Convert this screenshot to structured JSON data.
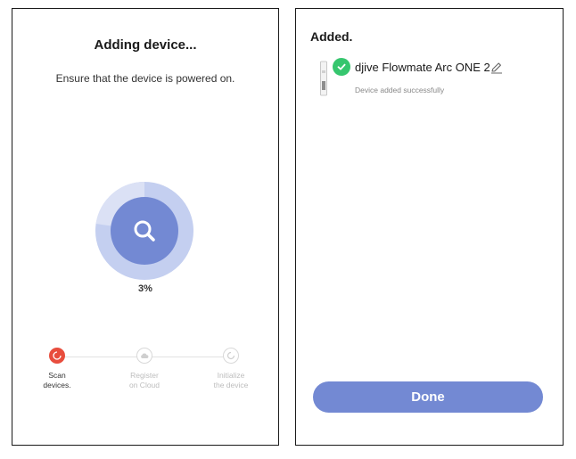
{
  "adding_screen": {
    "title": "Adding device...",
    "subtitle": "Ensure that the device is powered on.",
    "progress": {
      "value": 3,
      "label": "3%"
    },
    "steps": [
      {
        "label": "Scan\ndevices.",
        "state": "active"
      },
      {
        "label": "Register\non Cloud",
        "state": "inactive"
      },
      {
        "label": "Initialize\nthe device",
        "state": "inactive"
      }
    ],
    "icons": {
      "center": "search-icon",
      "step_1": "loading-icon",
      "step_2": "cloud-icon",
      "step_3": "refresh-icon"
    }
  },
  "added_screen": {
    "title": "Added.",
    "device": {
      "name": "djive Flowmate Arc ONE 2",
      "status": "Device added successfully",
      "thumbnail": "device-thumbnail",
      "badge": "check-icon",
      "edit": "pencil-icon"
    },
    "done_label": "Done"
  },
  "colors": {
    "accent": "#7389d3",
    "ring_outer": "#c4cff0",
    "ring_progress": "#dbe1f5",
    "ring_inner": "#7389d3",
    "step_active": "#e84d3d",
    "success": "#36c66e"
  }
}
